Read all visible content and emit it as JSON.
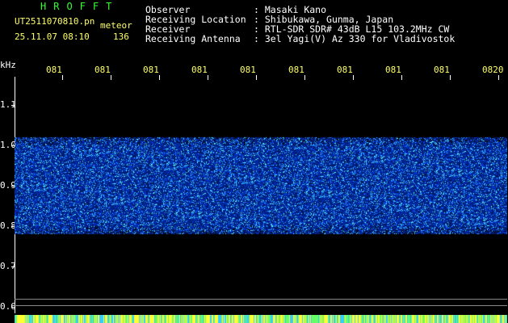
{
  "header": {
    "app_title": "HROFFT",
    "file_name": "UT2511070810.pn",
    "type_label": "meteor",
    "date_time": "25.11.07 08:10",
    "count": "136"
  },
  "meta": [
    {
      "key": "Observer",
      "sep": ":",
      "value": "Masaki Kano"
    },
    {
      "key": "Receiving Location",
      "sep": ":",
      "value": "Shibukawa, Gunma, Japan"
    },
    {
      "key": "Receiver",
      "sep": ":",
      "value": "RTL-SDR SDR# 43dB L15 103.2MHz CW"
    },
    {
      "key": "Receiving Antenna",
      "sep": ":",
      "value": "3el Yagi(V) Az 330 for Vladivostok"
    }
  ],
  "yaxis": {
    "unit": "kHz",
    "ticks": [
      {
        "label": "1.1",
        "value": 1.1
      },
      {
        "label": "1.0",
        "value": 1.0
      },
      {
        "label": "0.9",
        "value": 0.9
      },
      {
        "label": "0.8",
        "value": 0.8
      },
      {
        "label": "0.7",
        "value": 0.7
      },
      {
        "label": "0.6",
        "value": 0.6
      }
    ]
  },
  "xaxis": {
    "ticks": [
      "081",
      "081",
      "081",
      "081",
      "081",
      "081",
      "081",
      "081",
      "081",
      "0820"
    ]
  },
  "colors": {
    "text_white": "#ffffff",
    "text_yellow": "#ffff66",
    "title_green": "#33ff33",
    "noise_dark": "#001a66",
    "noise_mid": "#0033cc",
    "noise_bright": "#33aaff",
    "noise_cyan": "#66ffff"
  },
  "noise_band": {
    "min_khz": 0.78,
    "max_khz": 1.02
  }
}
